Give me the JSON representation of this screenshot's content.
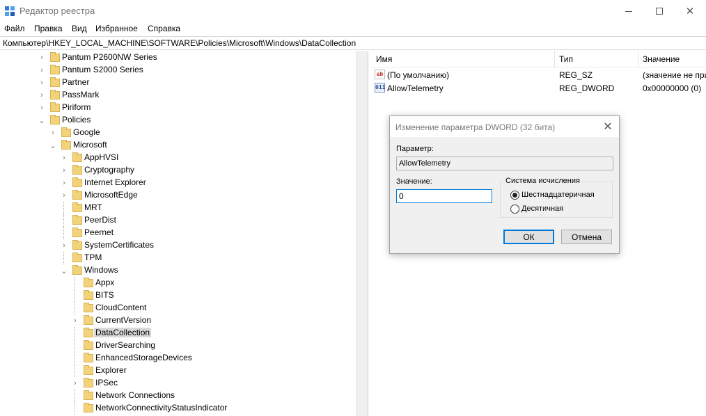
{
  "window": {
    "title": "Редактор реестра",
    "minimize_label": "—",
    "close_label": "✕"
  },
  "menu": [
    "Файл",
    "Правка",
    "Вид",
    "Избранное",
    "Справка"
  ],
  "address": "Компьютер\\HKEY_LOCAL_MACHINE\\SOFTWARE\\Policies\\Microsoft\\Windows\\DataCollection",
  "tree": [
    {
      "label": "Pantum P2600NW Series",
      "chevron": "›"
    },
    {
      "label": "Pantum S2000 Series",
      "chevron": "›"
    },
    {
      "label": "Partner",
      "chevron": "›"
    },
    {
      "label": "PassMark",
      "chevron": "›"
    },
    {
      "label": "Piriform",
      "chevron": "›"
    },
    {
      "label": "Policies",
      "chevron": "⌄"
    },
    {
      "label": "Google",
      "chevron": "›"
    },
    {
      "label": "Microsoft",
      "chevron": "⌄"
    },
    {
      "label": "AppHVSI",
      "chevron": "›"
    },
    {
      "label": "Cryptography",
      "chevron": "›"
    },
    {
      "label": "Internet Explorer",
      "chevron": "›"
    },
    {
      "label": "MicrosoftEdge",
      "chevron": "›"
    },
    {
      "label": "MRT",
      "chevron": ""
    },
    {
      "label": "PeerDist",
      "chevron": ""
    },
    {
      "label": "Peernet",
      "chevron": ""
    },
    {
      "label": "SystemCertificates",
      "chevron": "›"
    },
    {
      "label": "TPM",
      "chevron": ""
    },
    {
      "label": "Windows",
      "chevron": "⌄"
    },
    {
      "label": "Appx",
      "chevron": ""
    },
    {
      "label": "BITS",
      "chevron": ""
    },
    {
      "label": "CloudContent",
      "chevron": ""
    },
    {
      "label": "CurrentVersion",
      "chevron": "›"
    },
    {
      "label": "DataCollection",
      "chevron": "",
      "selected": true
    },
    {
      "label": "DriverSearching",
      "chevron": ""
    },
    {
      "label": "EnhancedStorageDevices",
      "chevron": ""
    },
    {
      "label": "Explorer",
      "chevron": ""
    },
    {
      "label": "IPSec",
      "chevron": "›"
    },
    {
      "label": "Network Connections",
      "chevron": ""
    },
    {
      "label": "NetworkConnectivityStatusIndicator",
      "chevron": ""
    }
  ],
  "list": {
    "columns": [
      "Имя",
      "Тип",
      "Значение"
    ],
    "rows": [
      {
        "icon": "ab",
        "icon_name": "string-value-icon",
        "name": "(По умолчанию)",
        "type": "REG_SZ",
        "value": "(значение не присвоено)"
      },
      {
        "icon": "011",
        "icon_name": "binary-value-icon",
        "name": "AllowTelemetry",
        "type": "REG_DWORD",
        "value": "0x00000000 (0)"
      }
    ]
  },
  "dialog": {
    "title": "Изменение параметра DWORD (32 бита)",
    "close_label": "✕",
    "param_label": "Параметр:",
    "param_value": "AllowTelemetry",
    "value_label": "Значение:",
    "value": "0",
    "base_group_label": "Система исчисления",
    "hex_label": "Шестнадцатеричная",
    "dec_label": "Десятичная",
    "selected_base": "hex",
    "ok_label": "ОК",
    "cancel_label": "Отмена"
  },
  "colors": {
    "folder": "#f2d37a",
    "accent": "#0078d7",
    "selection": "#d9d9d9"
  }
}
